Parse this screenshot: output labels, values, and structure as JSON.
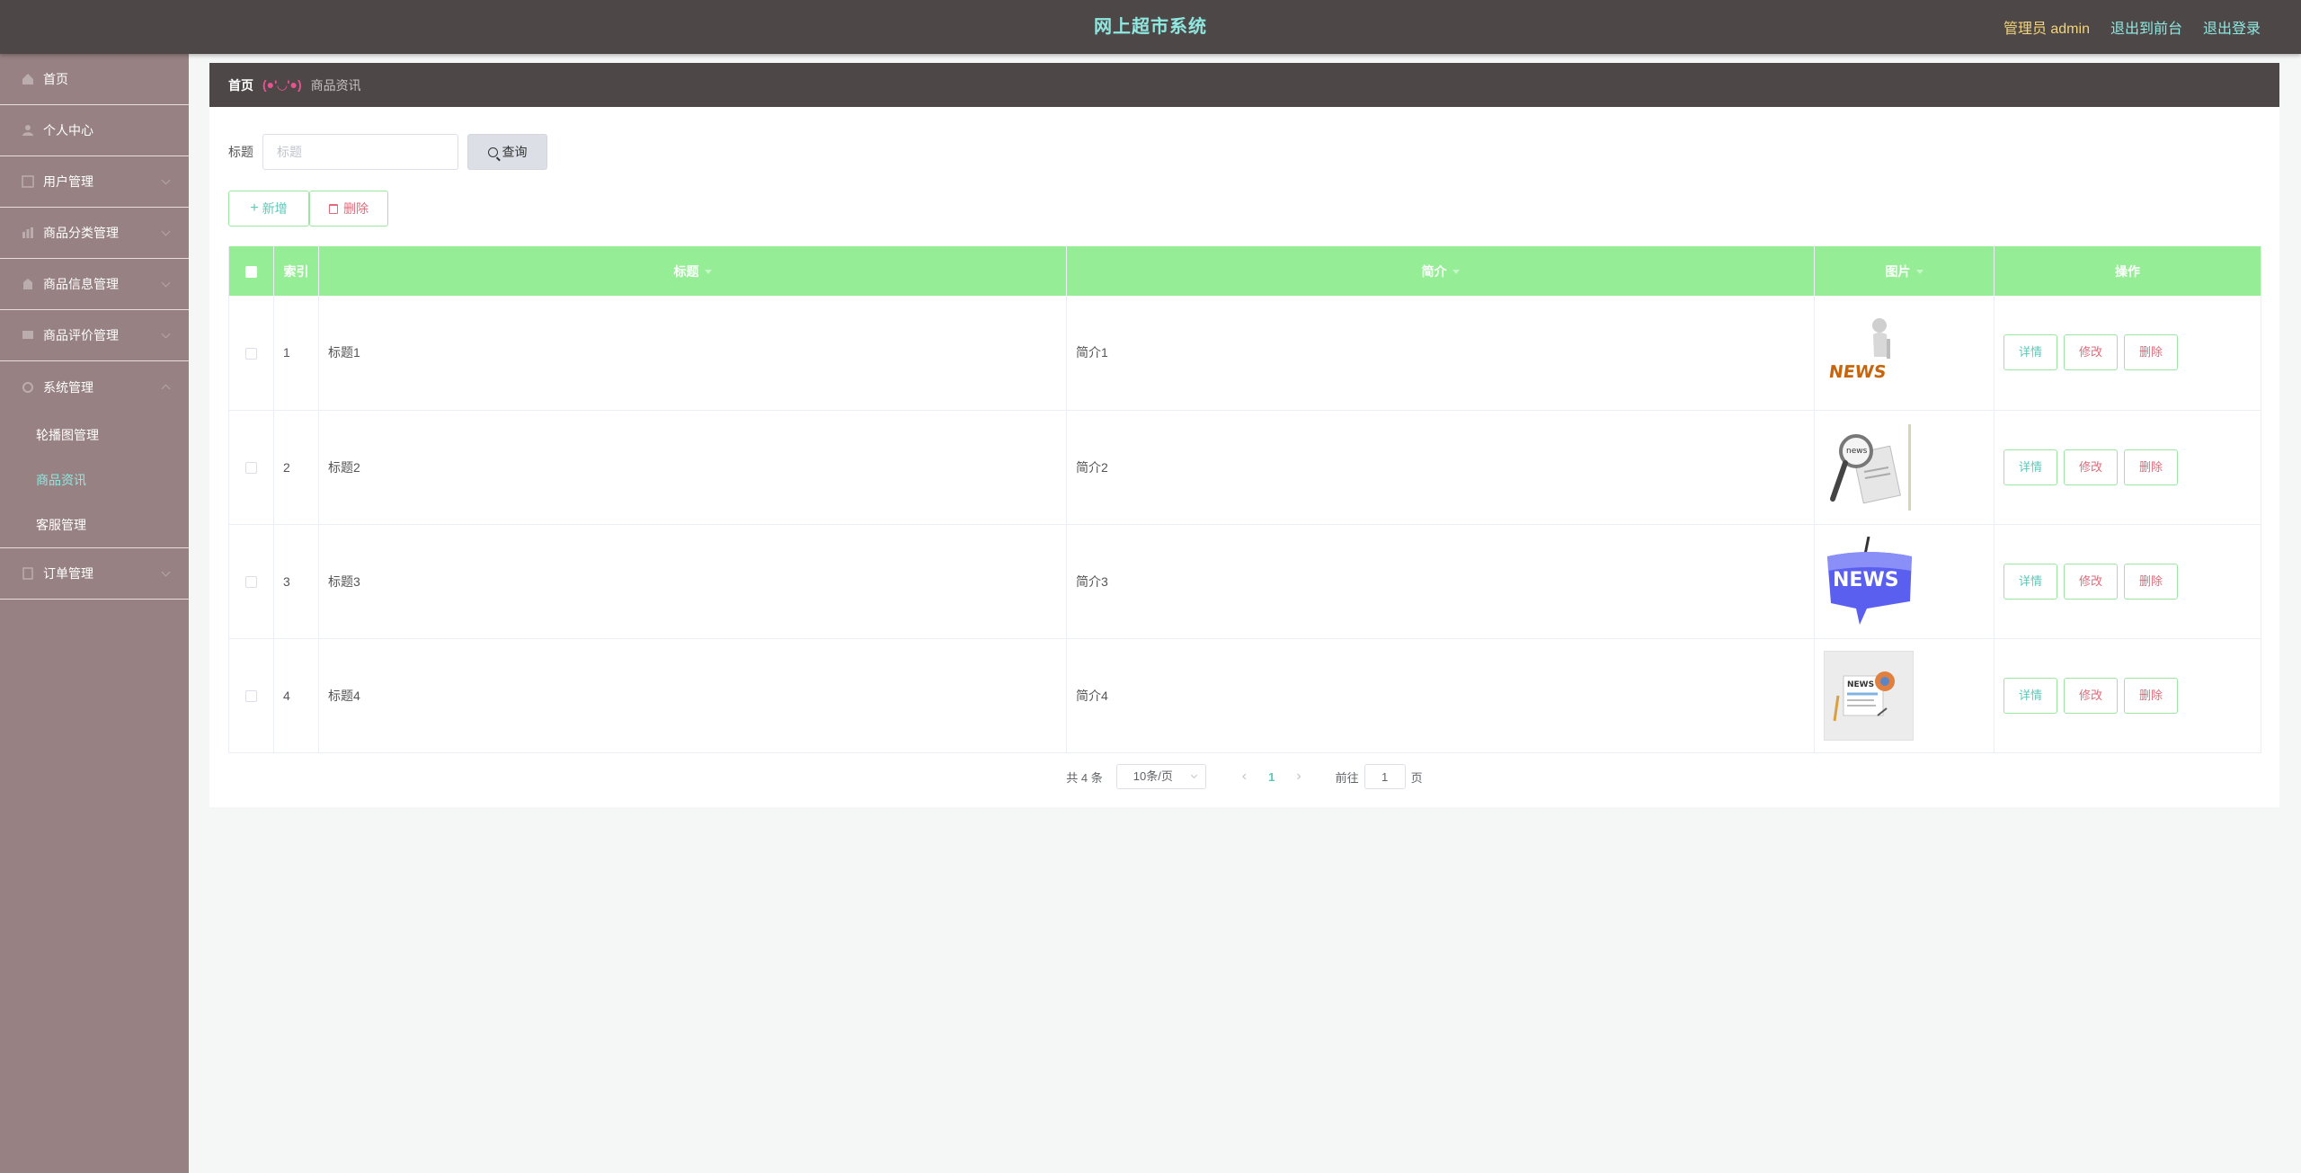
{
  "header": {
    "title": "网上超市系统",
    "admin_label": "管理员 admin",
    "front_link": "退出到前台",
    "logout_link": "退出登录"
  },
  "sidebar": {
    "items": [
      {
        "label": "首页",
        "icon": "home-icon"
      },
      {
        "label": "个人中心",
        "icon": "user-icon"
      },
      {
        "label": "用户管理",
        "icon": "users-icon"
      },
      {
        "label": "商品分类管理",
        "icon": "category-icon"
      },
      {
        "label": "商品信息管理",
        "icon": "goods-icon"
      },
      {
        "label": "商品评价管理",
        "icon": "comment-icon"
      },
      {
        "label": "系统管理",
        "icon": "settings-icon"
      },
      {
        "label": "订单管理",
        "icon": "order-icon"
      }
    ],
    "system_sub": [
      {
        "label": "轮播图管理"
      },
      {
        "label": "商品资讯"
      },
      {
        "label": "客服管理"
      }
    ]
  },
  "breadcrumb": {
    "home": "首页",
    "separator": "(●'◡'●)",
    "current": "商品资讯"
  },
  "search": {
    "label": "标题",
    "placeholder": "标题",
    "button": "查询"
  },
  "actions": {
    "add": "新增",
    "delete": "删除"
  },
  "table": {
    "columns": [
      "索引",
      "标题",
      "简介",
      "图片",
      "操作"
    ],
    "rows": [
      {
        "index": "1",
        "title": "标题1",
        "intro": "简介1",
        "image": "news-3d-figure"
      },
      {
        "index": "2",
        "title": "标题2",
        "intro": "简介2",
        "image": "news-magnifier"
      },
      {
        "index": "3",
        "title": "标题3",
        "intro": "简介3",
        "image": "news-blue-sign"
      },
      {
        "index": "4",
        "title": "标题4",
        "intro": "简介4",
        "image": "news-icon"
      }
    ],
    "row_buttons": {
      "detail": "详情",
      "edit": "修改",
      "delete": "删除"
    }
  },
  "pagination": {
    "total": "共 4 条",
    "page_size": "10条/页",
    "current_page": "1",
    "goto_label": "前往",
    "goto_value": "1",
    "page_suffix": "页"
  },
  "colors": {
    "header_bg": "#4d4748",
    "sidebar_bg": "#978182",
    "accent": "#8fe8e0",
    "table_header": "#95ee95",
    "danger": "#e06a7a"
  }
}
